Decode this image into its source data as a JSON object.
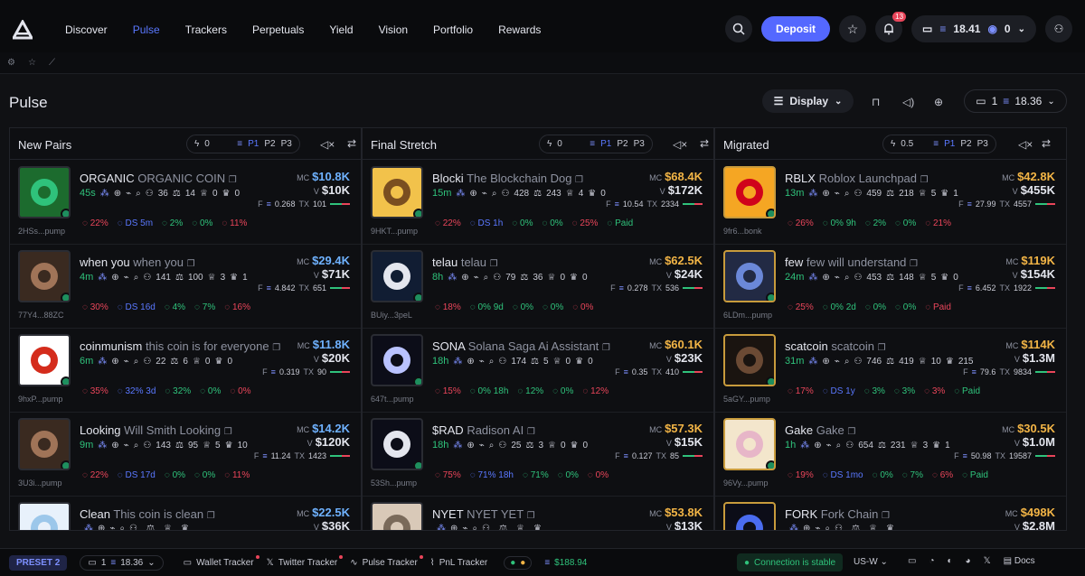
{
  "nav": {
    "items": [
      "Discover",
      "Pulse",
      "Trackers",
      "Perpetuals",
      "Yield",
      "Vision",
      "Portfolio",
      "Rewards"
    ],
    "active": "Pulse"
  },
  "topbar": {
    "deposit_label": "Deposit",
    "notif_count": "13",
    "wallet_balance": "18.41",
    "wallet_second": "0"
  },
  "page": {
    "title": "Pulse",
    "display_label": "Display",
    "preset_count": "1",
    "preset_balance": "18.36"
  },
  "columns": [
    {
      "title": "New Pairs",
      "ctrl_value": "0",
      "presets": [
        "P1",
        "P2",
        "P3"
      ],
      "rows": [
        {
          "ticker": "ORGANIC",
          "name": "ORGANIC COIN",
          "age": "45s",
          "addr": "2HSs...pump",
          "holders": "36",
          "pro": "14",
          "cups": "0",
          "crowns": "0",
          "mc": "$10.8K",
          "v": "$10K",
          "f": "0.268",
          "tx": "101",
          "stats": [
            "22%",
            "DS 5m",
            "2%",
            "0%",
            "11%"
          ]
        },
        {
          "ticker": "when you",
          "name": "when you",
          "age": "4m",
          "addr": "77Y4...88ZC",
          "holders": "141",
          "pro": "100",
          "cups": "3",
          "crowns": "1",
          "mc": "$29.4K",
          "v": "$71K",
          "f": "4.842",
          "tx": "651",
          "stats": [
            "30%",
            "DS 16d",
            "4%",
            "7%",
            "16%"
          ]
        },
        {
          "ticker": "coinmunism",
          "name": "this coin is for everyone",
          "age": "6m",
          "addr": "9hxP...pump",
          "holders": "22",
          "pro": "6",
          "cups": "0",
          "crowns": "0",
          "mc": "$11.8K",
          "v": "$20K",
          "f": "0.319",
          "tx": "90",
          "stats": [
            "35%",
            "32% 3d",
            "32%",
            "0%",
            "0%"
          ]
        },
        {
          "ticker": "Looking",
          "name": "Will Smith Looking",
          "age": "9m",
          "addr": "3U3i...pump",
          "holders": "143",
          "pro": "95",
          "cups": "5",
          "crowns": "10",
          "mc": "$14.2K",
          "v": "$120K",
          "f": "11.24",
          "tx": "1423",
          "stats": [
            "22%",
            "DS 17d",
            "0%",
            "0%",
            "11%"
          ]
        },
        {
          "ticker": "Clean",
          "name": "This coin is clean",
          "age": "",
          "addr": "",
          "holders": "",
          "pro": "",
          "cups": "",
          "crowns": "",
          "mc": "$22.5K",
          "v": "$36K",
          "f": "",
          "tx": "",
          "stats": []
        }
      ]
    },
    {
      "title": "Final Stretch",
      "ctrl_value": "0",
      "presets": [
        "P1",
        "P2",
        "P3"
      ],
      "rows": [
        {
          "ticker": "Blocki",
          "name": "The Blockchain Dog",
          "age": "15m",
          "addr": "9HKT...pump",
          "holders": "428",
          "pro": "243",
          "cups": "4",
          "crowns": "0",
          "mc": "$68.4K",
          "v": "$172K",
          "f": "10.54",
          "tx": "2334",
          "stats": [
            "22%",
            "DS 1h",
            "0%",
            "0%",
            "25%",
            "Paid"
          ]
        },
        {
          "ticker": "telau",
          "name": "telau",
          "age": "8h",
          "addr": "BUiy...3peL",
          "holders": "79",
          "pro": "36",
          "cups": "0",
          "crowns": "0",
          "mc": "$62.5K",
          "v": "$24K",
          "f": "0.278",
          "tx": "536",
          "stats": [
            "18%",
            "0% 9d",
            "0%",
            "0%",
            "0%"
          ]
        },
        {
          "ticker": "SONA",
          "name": "Solana Saga Ai Assistant",
          "age": "18h",
          "addr": "647t...pump",
          "holders": "174",
          "pro": "5",
          "cups": "0",
          "crowns": "0",
          "mc": "$60.1K",
          "v": "$23K",
          "f": "0.35",
          "tx": "410",
          "stats": [
            "15%",
            "0% 18h",
            "12%",
            "0%",
            "12%"
          ]
        },
        {
          "ticker": "$RAD",
          "name": "Radison AI",
          "age": "18h",
          "addr": "53Sh...pump",
          "holders": "25",
          "pro": "3",
          "cups": "0",
          "crowns": "0",
          "mc": "$57.3K",
          "v": "$15K",
          "f": "0.127",
          "tx": "85",
          "stats": [
            "75%",
            "71% 18h",
            "71%",
            "0%",
            "0%"
          ]
        },
        {
          "ticker": "NYET",
          "name": "NYET YET",
          "age": "",
          "addr": "",
          "holders": "",
          "pro": "",
          "cups": "",
          "crowns": "",
          "mc": "$53.8K",
          "v": "$13K",
          "f": "",
          "tx": "",
          "stats": []
        }
      ]
    },
    {
      "title": "Migrated",
      "ctrl_value": "0.5",
      "presets": [
        "P1",
        "P2",
        "P3"
      ],
      "rows": [
        {
          "ticker": "RBLX",
          "name": "Roblox Launchpad",
          "age": "13m",
          "addr": "9fr6...bonk",
          "holders": "459",
          "pro": "218",
          "cups": "5",
          "crowns": "1",
          "mc": "$42.8K",
          "v": "$455K",
          "f": "27.99",
          "tx": "4557",
          "stats": [
            "26%",
            "0% 9h",
            "2%",
            "0%",
            "21%"
          ]
        },
        {
          "ticker": "few",
          "name": "few will understand",
          "age": "24m",
          "addr": "6LDm...pump",
          "holders": "453",
          "pro": "148",
          "cups": "5",
          "crowns": "0",
          "mc": "$119K",
          "v": "$154K",
          "f": "6.452",
          "tx": "1922",
          "stats": [
            "25%",
            "0% 2d",
            "0%",
            "0%",
            "Paid"
          ]
        },
        {
          "ticker": "scatcoin",
          "name": "scatcoin",
          "age": "31m",
          "addr": "5aGY...pump",
          "holders": "746",
          "pro": "419",
          "cups": "10",
          "crowns": "215",
          "mc": "$114K",
          "v": "$1.3M",
          "f": "79.6",
          "tx": "9834",
          "stats": [
            "17%",
            "DS 1y",
            "3%",
            "3%",
            "3%",
            "Paid"
          ]
        },
        {
          "ticker": "Gake",
          "name": "Gake",
          "age": "1h",
          "addr": "96Vy...pump",
          "holders": "654",
          "pro": "231",
          "cups": "3",
          "crowns": "1",
          "mc": "$30.5K",
          "v": "$1.0M",
          "f": "50.98",
          "tx": "19587",
          "stats": [
            "19%",
            "DS 1mo",
            "0%",
            "7%",
            "6%",
            "Paid"
          ]
        },
        {
          "ticker": "FORK",
          "name": "Fork Chain",
          "age": "",
          "addr": "",
          "holders": "",
          "pro": "",
          "cups": "",
          "crowns": "",
          "mc": "$498K",
          "v": "$2.8M",
          "f": "",
          "tx": "",
          "stats": []
        }
      ]
    }
  ],
  "bottombar": {
    "preset": "PRESET 2",
    "count": "1",
    "balance": "18.36",
    "wallet_tracker": "Wallet Tracker",
    "twitter_tracker": "Twitter Tracker",
    "pulse_tracker": "Pulse Tracker",
    "pnl_tracker": "PnL Tracker",
    "sol_price": "$188.94",
    "connection": "Connection is stable",
    "region": "US-W",
    "docs": "Docs"
  },
  "colors": {
    "accent": "#5468ff",
    "green": "#2fc27b",
    "red": "#e9455a",
    "gold": "#f3b546",
    "blue": "#6fb2ff"
  }
}
